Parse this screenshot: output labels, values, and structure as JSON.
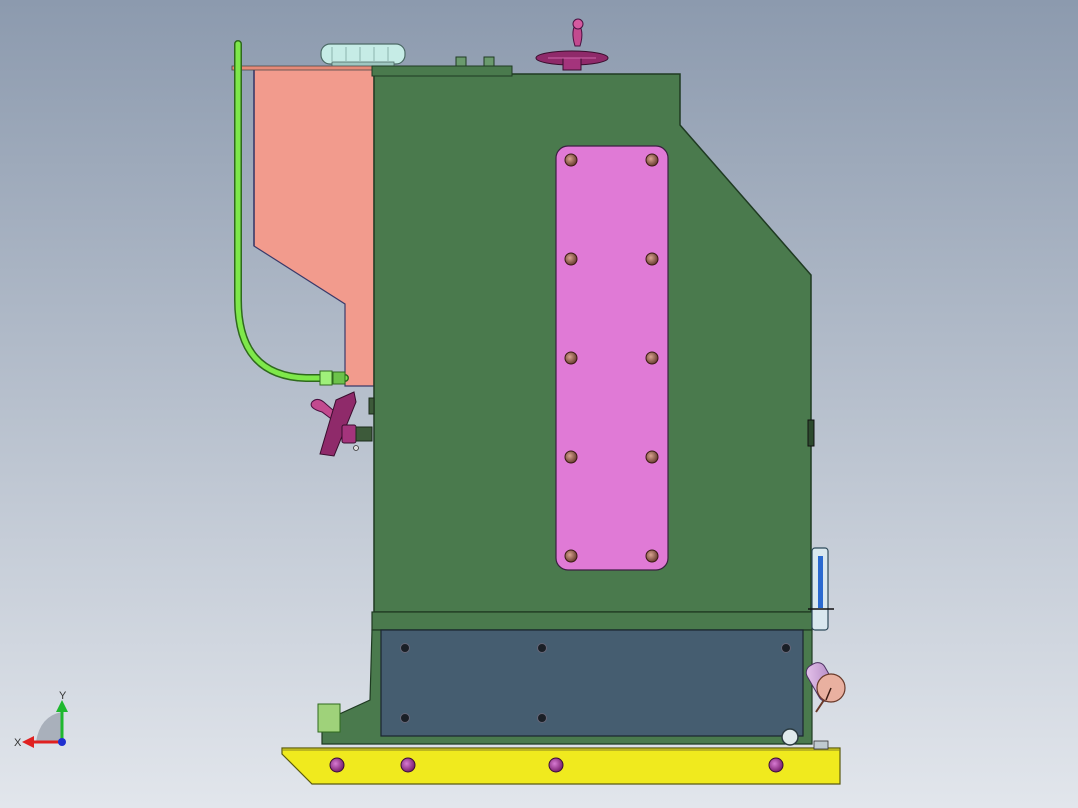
{
  "viewport": {
    "background_top": "#8c9aae",
    "background_bottom": "#e2e6ec"
  },
  "model": {
    "body_color": "#4a7a4d",
    "tank_color": "#f29b8d",
    "cover_plate_color": "#e07ad6",
    "lower_panel_color": "#455d70",
    "base_color": "#f0ea1e",
    "pipe_color": "#7ee84a",
    "handwheel_color": "#8f2a6a",
    "bolt_color": "#9b6a5a",
    "cap_color": "#c6ece6",
    "gauge_color": "#e9b0a0"
  },
  "triad": {
    "x_label": "X",
    "y_label": "Y",
    "x_color": "#e02020",
    "y_color": "#1fb82f",
    "z_color": "#2030d0"
  }
}
